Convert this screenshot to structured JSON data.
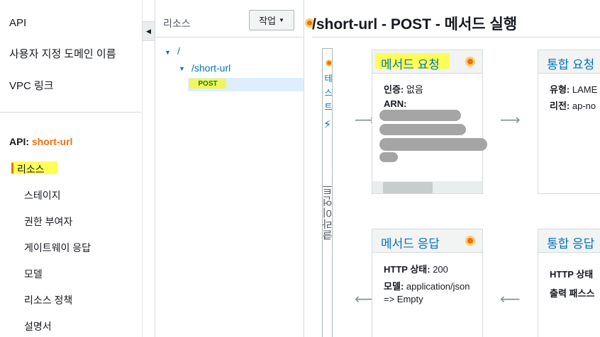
{
  "left_nav": {
    "top_items": [
      "API",
      "사용자 지정 도메인 이름",
      "VPC 링크"
    ],
    "api_label": "API:",
    "api_name": "short-url",
    "active_item": "리소스",
    "items": [
      "스테이지",
      "권한 부여자",
      "게이트웨이 응답",
      "모델",
      "리소스 정책",
      "설명서"
    ]
  },
  "resources_panel": {
    "title": "리소스",
    "actions_button": "작업",
    "tree": {
      "root": "/",
      "child": "/short-url",
      "method": "POST"
    }
  },
  "main": {
    "title": "/short-url - POST - 메서드 실행",
    "client": {
      "test_chars": [
        "테",
        "스",
        "트"
      ],
      "label": "클라이언트"
    },
    "method_request": {
      "title": "메서드 요청",
      "auth_label": "인증:",
      "auth_value": "없음",
      "arn_label": "ARN:"
    },
    "integration_request": {
      "title": "통합 요청",
      "type_label": "유형:",
      "type_value": "LAME",
      "region_label": "리전:",
      "region_value": "ap-no"
    },
    "method_response": {
      "title": "메서드 응답",
      "http_status_label": "HTTP 상태:",
      "http_status_value": "200",
      "model_label": "모델:",
      "model_value": "application/json",
      "model_value_2": "=> Empty"
    },
    "integration_response": {
      "title": "통합 응답",
      "http_status_label": "HTTP 상태",
      "output_label": "출력 패스스"
    }
  },
  "colors": {
    "accent_orange": "#ec7211",
    "link_blue": "#0073bb",
    "highlight_yellow": "#ffff3a",
    "method_green": "#1d8102"
  },
  "icons": [
    "collapse-left-icon",
    "caret-down-icon",
    "lightning-bolt-icon",
    "arrow-right-icon",
    "arrow-left-icon"
  ]
}
